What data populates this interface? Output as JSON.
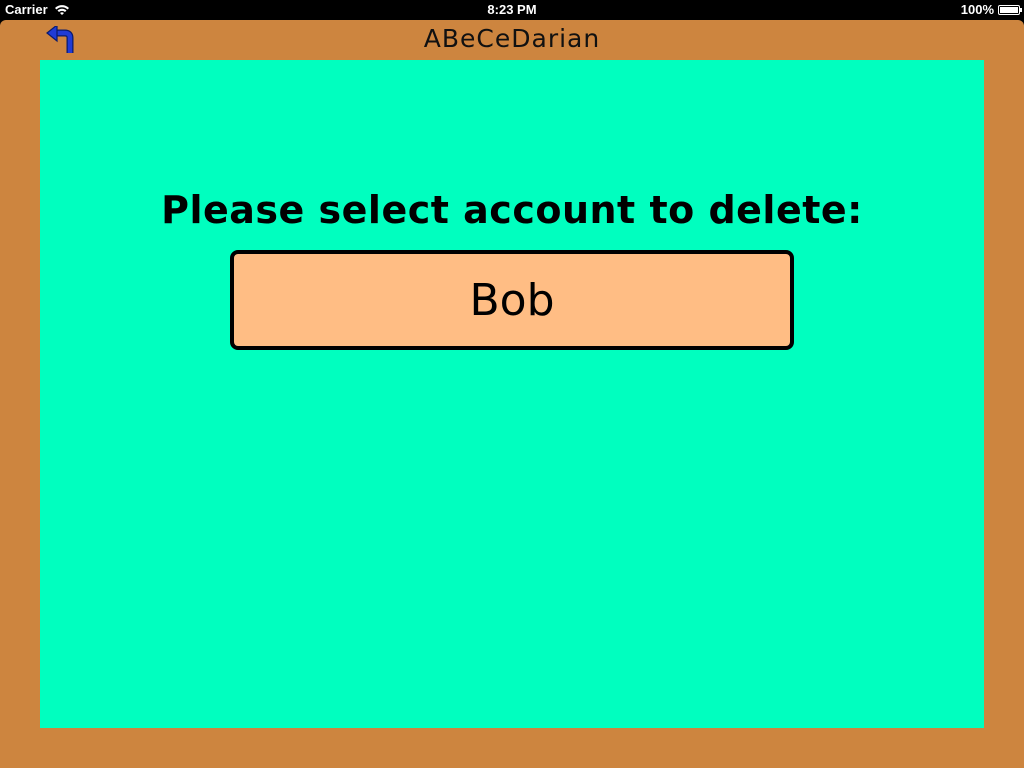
{
  "status_bar": {
    "carrier": "Carrier",
    "time": "8:23 PM",
    "battery": "100%",
    "wifi_icon": "wifi-icon",
    "battery_icon": "battery-icon"
  },
  "header": {
    "title": "ABeCeDarian",
    "back_icon": "undo-arrow-icon",
    "back_icon_color": "#1F3BD6"
  },
  "main": {
    "prompt": "Please select account to delete:",
    "accounts": [
      {
        "label": "Bob"
      }
    ]
  },
  "colors": {
    "frame": "#CD853F",
    "panel": "#00FFBF",
    "account_button": "#FFBD84",
    "status_bar": "#000000"
  }
}
